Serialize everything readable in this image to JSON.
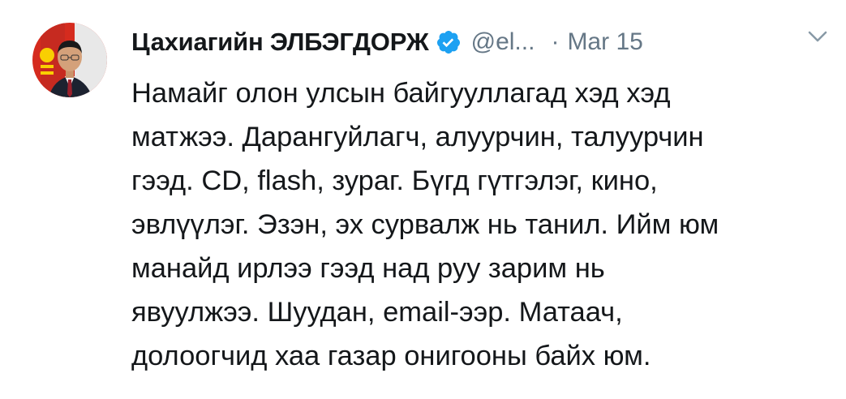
{
  "tweet": {
    "author": {
      "display_name": "Цахиагийн ЭЛБЭГДОРЖ",
      "handle": "@el...",
      "avatar_icon": "profile-photo"
    },
    "separator": "·",
    "date": "Mar 15",
    "menu_icon": "chevron-down-icon",
    "verified_icon": "verified-badge-icon",
    "colors": {
      "verified_blue": "#1da1f2",
      "secondary_text": "#657786",
      "primary_text": "#14171a"
    },
    "text_lines": [
      "Намайг олон улсын байгууллагад хэд хэд",
      "матжээ. Дарангуйлагч, алуурчин, талуурчин",
      "гээд. CD, flash, зураг. Бүгд гүтгэлэг, кино,",
      "эвлүүлэг. Эзэн, эх сурвалж нь танил. Ийм юм",
      "манайд ирлээ гээд над руу зарим нь",
      "явуулжээ. Шуудан, email-ээр. Матаач,",
      "долоогчид хаа газар онигооны байх юм."
    ]
  }
}
